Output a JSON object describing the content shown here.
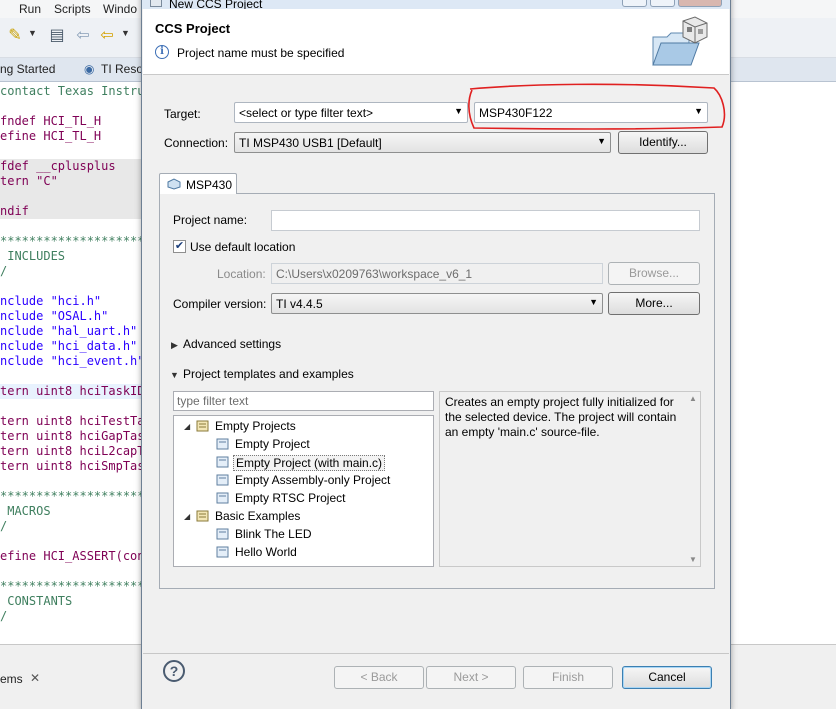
{
  "ide": {
    "menu": [
      "Run",
      "Scripts",
      "Windo"
    ],
    "tabs": [
      "ng Started",
      "TI Reso"
    ],
    "code_lines": [
      {
        "text": "contact Texas Instru",
        "cls": "c-comment",
        "bg": ""
      },
      {
        "text": "",
        "cls": "c-plain",
        "bg": ""
      },
      {
        "text": "fndef HCI_TL_H",
        "cls": "c-kw",
        "bg": ""
      },
      {
        "text": "efine HCI_TL_H",
        "cls": "c-kw",
        "bg": ""
      },
      {
        "text": "",
        "cls": "c-plain",
        "bg": ""
      },
      {
        "text": "fdef __cplusplus",
        "cls": "c-kw",
        "bg": "gray"
      },
      {
        "text": "tern \"C\"",
        "cls": "c-kw",
        "bg": "gray"
      },
      {
        "text": "",
        "cls": "c-plain",
        "bg": "gray"
      },
      {
        "text": "ndif",
        "cls": "c-kw",
        "bg": "gray"
      },
      {
        "text": "",
        "cls": "c-plain",
        "bg": ""
      },
      {
        "text": "**********************",
        "cls": "c-comment",
        "bg": ""
      },
      {
        "text": " INCLUDES",
        "cls": "c-comment",
        "bg": ""
      },
      {
        "text": "/",
        "cls": "c-comment",
        "bg": ""
      },
      {
        "text": "",
        "cls": "c-plain",
        "bg": ""
      },
      {
        "text": "nclude \"hci.h\"",
        "cls": "c-str",
        "bg": ""
      },
      {
        "text": "nclude \"OSAL.h\"",
        "cls": "c-str",
        "bg": ""
      },
      {
        "text": "nclude \"hal_uart.h\"",
        "cls": "c-str",
        "bg": ""
      },
      {
        "text": "nclude \"hci_data.h\"",
        "cls": "c-str",
        "bg": ""
      },
      {
        "text": "nclude \"hci_event.h\"",
        "cls": "c-str",
        "bg": ""
      },
      {
        "text": "",
        "cls": "c-plain",
        "bg": ""
      },
      {
        "text": "tern uint8 hciTaskID",
        "cls": "c-kw",
        "bg": "hl"
      },
      {
        "text": "",
        "cls": "c-plain",
        "bg": ""
      },
      {
        "text": "tern uint8 hciTestTa",
        "cls": "c-kw",
        "bg": ""
      },
      {
        "text": "tern uint8 hciGapTas",
        "cls": "c-kw",
        "bg": ""
      },
      {
        "text": "tern uint8 hciL2capT",
        "cls": "c-kw",
        "bg": ""
      },
      {
        "text": "tern uint8 hciSmpTas",
        "cls": "c-kw",
        "bg": ""
      },
      {
        "text": "",
        "cls": "c-plain",
        "bg": ""
      },
      {
        "text": "**********************",
        "cls": "c-comment",
        "bg": ""
      },
      {
        "text": " MACROS",
        "cls": "c-comment",
        "bg": ""
      },
      {
        "text": "/",
        "cls": "c-comment",
        "bg": ""
      },
      {
        "text": "",
        "cls": "c-plain",
        "bg": ""
      },
      {
        "text": "efine HCI_ASSERT(con",
        "cls": "c-kw",
        "bg": ""
      },
      {
        "text": "",
        "cls": "c-plain",
        "bg": ""
      },
      {
        "text": "**********************",
        "cls": "c-comment",
        "bg": ""
      },
      {
        "text": " CONSTANTS",
        "cls": "c-comment",
        "bg": ""
      },
      {
        "text": "/",
        "cls": "c-comment",
        "bg": ""
      }
    ],
    "bottom_tab": "ems"
  },
  "dialog": {
    "title": "New CCS Project",
    "header_title": "CCS Project",
    "header_message": "Project name must be specified",
    "target_label": "Target:",
    "target_filter_text": "<select or type filter text>",
    "target_device": "MSP430F122",
    "connection_label": "Connection:",
    "connection_value": "TI MSP430 USB1 [Default]",
    "identify_button": "Identify...",
    "tab_label": "MSP430",
    "project_name_label": "Project name:",
    "project_name_value": "",
    "use_default_location_label": "Use default location",
    "use_default_location_checked": true,
    "location_label": "Location:",
    "location_value": "C:\\Users\\x0209763\\workspace_v6_1",
    "browse_button": "Browse...",
    "compiler_label": "Compiler version:",
    "compiler_value": "TI v4.4.5",
    "more_button": "More...",
    "advanced_settings_label": "Advanced settings",
    "templates_label": "Project templates and examples",
    "filter_placeholder": "type filter text",
    "tree": {
      "group1": "Empty Projects",
      "items1": [
        "Empty Project",
        "Empty Project (with main.c)",
        "Empty Assembly-only Project",
        "Empty RTSC Project"
      ],
      "selected": "Empty Project (with main.c)",
      "group2": "Basic Examples",
      "items2": [
        "Blink The LED",
        "Hello World"
      ]
    },
    "description": "Creates an empty project fully initialized for the selected device. The project will contain an empty 'main.c' source-file.",
    "buttons": {
      "back": "< Back",
      "next": "Next >",
      "finish": "Finish",
      "cancel": "Cancel"
    },
    "annotation_color": "#e02020"
  }
}
